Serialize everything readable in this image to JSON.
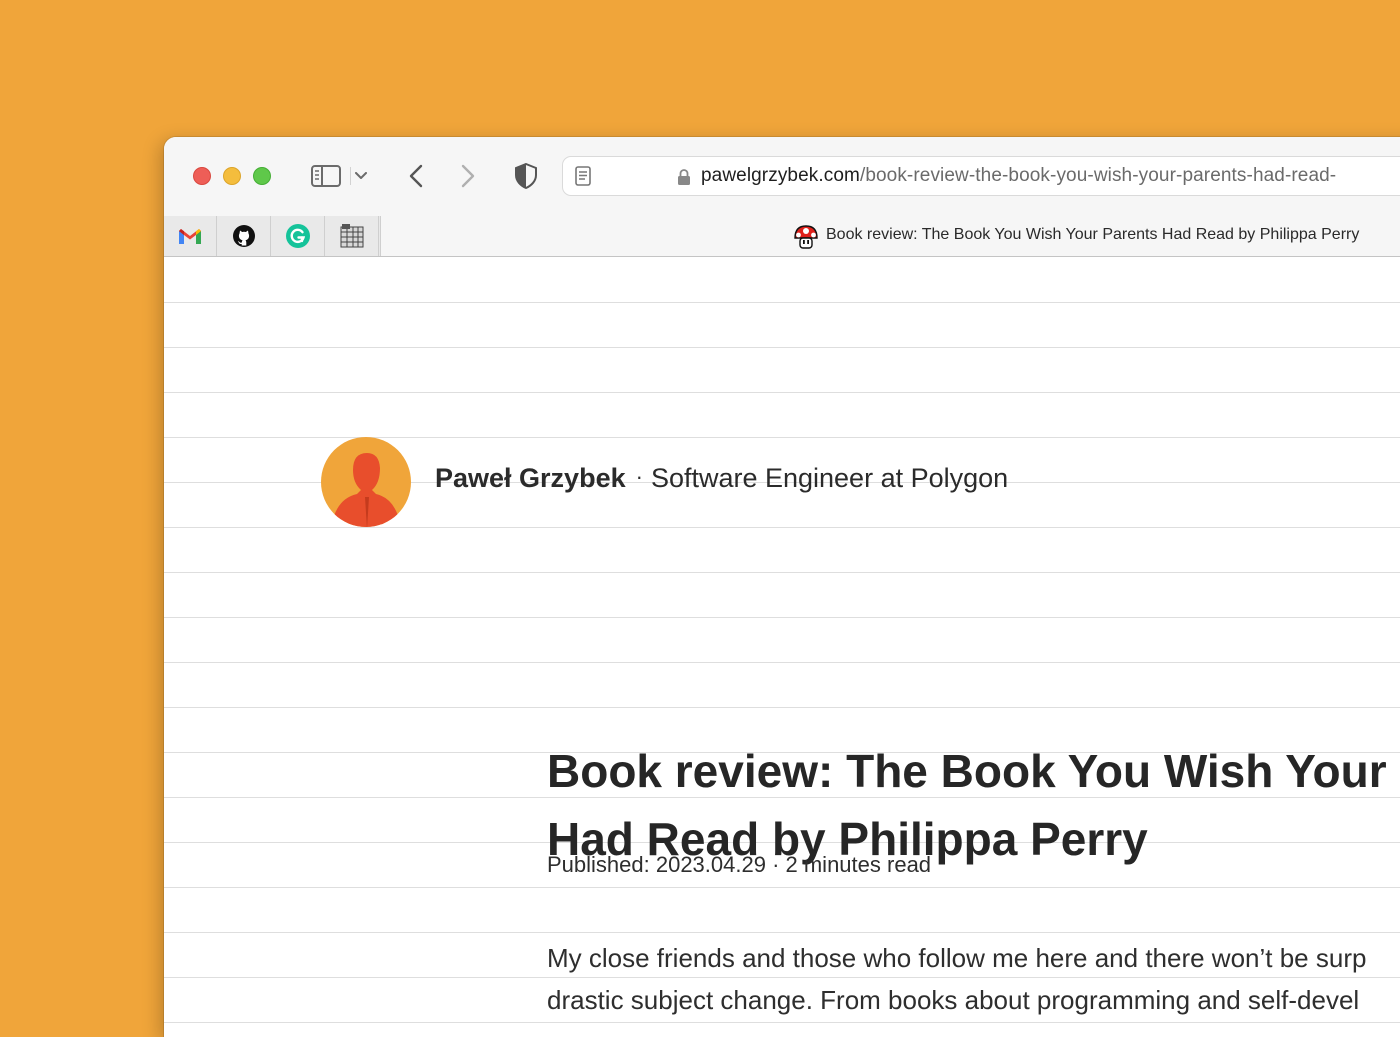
{
  "browser": {
    "url_host": "pawelgrzybek.com",
    "url_path": "/book-review-the-book-you-wish-your-parents-had-read-",
    "tab_title": "Book review: The Book You Wish Your Parents Had Read by Philippa Perry",
    "pinned_tabs": [
      "gmail-icon",
      "github-icon",
      "grammarly-icon",
      "spreadsheet-icon"
    ]
  },
  "colors": {
    "desktop_background": "#f0a53a",
    "avatar_background": "#f0a53a",
    "avatar_figure": "#e84e2c"
  },
  "page": {
    "author_name": "Paweł Grzybek",
    "separator": "·",
    "author_role": "Software Engineer at Polygon",
    "title_line1": "Book review: The Book You Wish Your P",
    "title_line2": "Had Read by Philippa Perry",
    "meta": "Published: 2023.04.29 · 2 minutes read",
    "paragraph_line1": "My close friends and those who follow me here and there won’t be surp",
    "paragraph_line2": "drastic subject change. From books about programming and self-devel"
  }
}
